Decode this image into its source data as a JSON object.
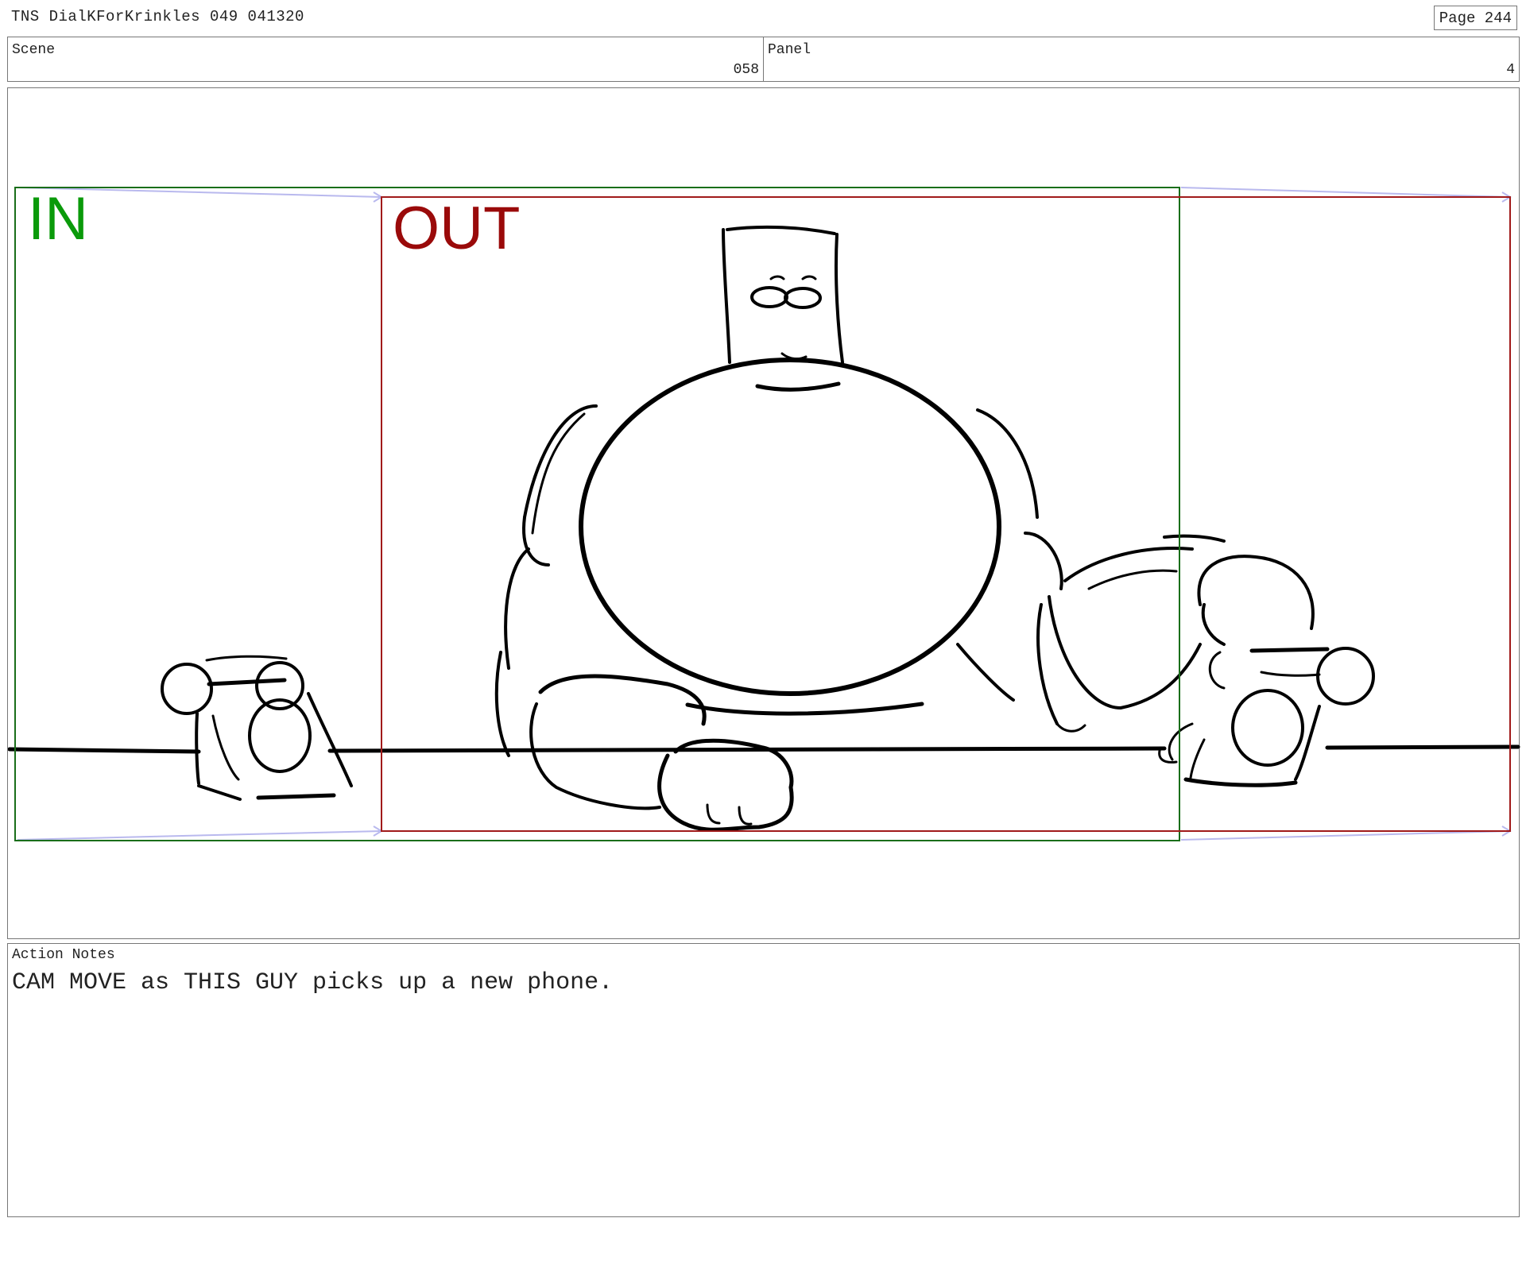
{
  "header": {
    "title": "TNS DialKForKrinkles 049 041320",
    "page": "Page 244"
  },
  "scene": {
    "label": "Scene",
    "value": "058"
  },
  "panel": {
    "label": "Panel",
    "value": "4"
  },
  "frame": {
    "in_label": "IN",
    "out_label": "OUT",
    "in_color": "#0a8f0a",
    "out_color": "#9a0a0a",
    "arrow_color": "#b9b9ee"
  },
  "notes": {
    "label": "Action Notes",
    "text": "CAM MOVE as THIS GUY picks up a new phone."
  }
}
